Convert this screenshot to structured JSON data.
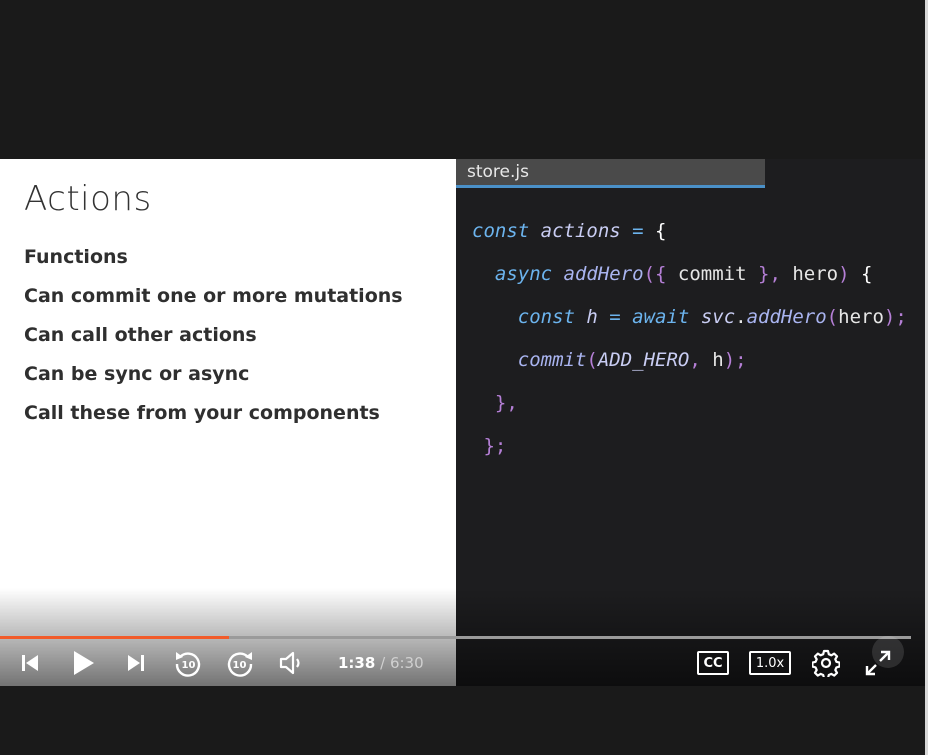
{
  "slide": {
    "title": "Actions",
    "bullets": [
      "Functions",
      "Can commit one or more mutations",
      "Can call other actions",
      "Can be sync or async",
      "Call these from your components"
    ]
  },
  "code": {
    "file_tab": "store.js",
    "lines": [
      [
        {
          "t": "const ",
          "c": "kw"
        },
        {
          "t": "actions ",
          "c": "vr"
        },
        {
          "t": "= ",
          "c": "kw"
        },
        {
          "t": "{",
          "c": "br"
        }
      ],
      [
        {
          "t": "  async ",
          "c": "kw"
        },
        {
          "t": "addHero",
          "c": "fn"
        },
        {
          "t": "({ ",
          "c": "pn"
        },
        {
          "t": "commit ",
          "c": "id"
        },
        {
          "t": "}, ",
          "c": "pn"
        },
        {
          "t": "hero",
          "c": "id"
        },
        {
          "t": ") ",
          "c": "pn"
        },
        {
          "t": "{",
          "c": "br"
        }
      ],
      [
        {
          "t": "    const ",
          "c": "kw"
        },
        {
          "t": "h ",
          "c": "vr"
        },
        {
          "t": "= ",
          "c": "kw"
        },
        {
          "t": "await ",
          "c": "kw"
        },
        {
          "t": "svc",
          "c": "vr"
        },
        {
          "t": ".",
          "c": "id"
        },
        {
          "t": "addHero",
          "c": "fn"
        },
        {
          "t": "(",
          "c": "pn"
        },
        {
          "t": "hero",
          "c": "id"
        },
        {
          "t": ");",
          "c": "pn"
        }
      ],
      [
        {
          "t": "    commit",
          "c": "fn"
        },
        {
          "t": "(",
          "c": "pn"
        },
        {
          "t": "ADD_HERO",
          "c": "vr"
        },
        {
          "t": ", ",
          "c": "pn"
        },
        {
          "t": "h",
          "c": "id"
        },
        {
          "t": ");",
          "c": "pn"
        }
      ],
      [
        {
          "t": "  },",
          "c": "pn"
        }
      ],
      [
        {
          "t": " };",
          "c": "pn"
        }
      ]
    ]
  },
  "player": {
    "current_time": "1:38",
    "separator": "/",
    "duration": "6:30",
    "progress_fraction": 0.251,
    "captions_label": "CC",
    "speed_label": "1.0x",
    "progress_color": "#f15b2a",
    "icons": {
      "previous": "skip-previous-icon",
      "play": "play-icon",
      "next": "skip-next-icon",
      "rewind": "rewind-10-icon",
      "forward": "forward-10-icon",
      "volume": "volume-icon",
      "settings": "gear-icon",
      "fullscreen": "expand-icon"
    }
  }
}
